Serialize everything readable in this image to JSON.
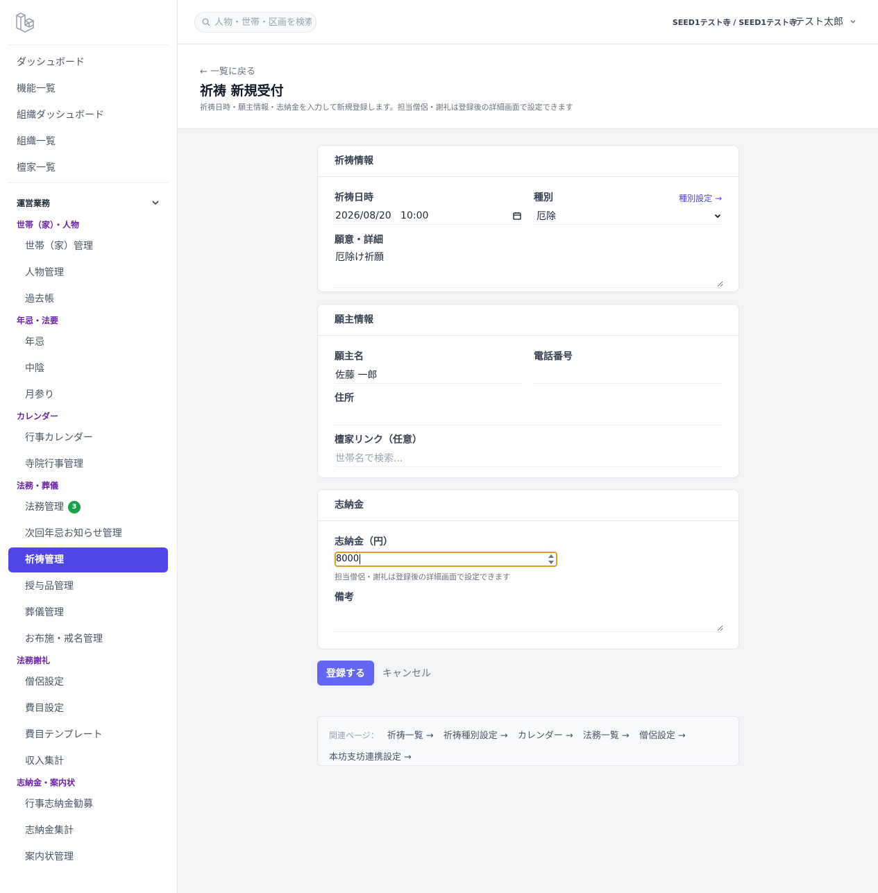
{
  "search": {
    "placeholder": "人物・世帯・区画を検索"
  },
  "header": {
    "org": "SEED1テスト寺 / SEED1テスト寺",
    "user": "テスト太郎"
  },
  "sidebar": {
    "top_items": [
      "ダッシュボード",
      "機能一覧",
      "組織ダッシュボード",
      "組織一覧",
      "檀家一覧"
    ],
    "group_label": "運営業務",
    "sections": [
      {
        "title": "世帯（家）・人物",
        "items": [
          "世帯（家）管理",
          "人物管理",
          "過去帳"
        ]
      },
      {
        "title": "年忌・法要",
        "items": [
          "年忌",
          "中陰",
          "月参り"
        ]
      },
      {
        "title": "カレンダー",
        "items": [
          "行事カレンダー",
          "寺院行事管理"
        ]
      },
      {
        "title": "法務・葬儀",
        "items": [
          "法務管理",
          "次回年忌お知らせ管理",
          "祈祷管理",
          "授与品管理",
          "葬儀管理",
          "お布施・戒名管理"
        ]
      },
      {
        "title": "法務謝礼",
        "items": [
          "僧侶設定",
          "費目設定",
          "費目テンプレート",
          "収入集計"
        ]
      },
      {
        "title": "志納金・案内状",
        "items": [
          "行事志納金勧募",
          "志納金集計",
          "案内状管理"
        ]
      }
    ],
    "badge_count": "3"
  },
  "page": {
    "back": "← 一覧に戻る",
    "title": "祈祷 新規受付",
    "subtitle": "祈祷日時・願主情報・志納金を入力して新規登録します。担当僧侶・謝礼は登録後の詳細画面で設定できます"
  },
  "prayer_card": {
    "title": "祈祷情報",
    "datetime_label": "祈祷日時",
    "datetime_value": "2026/08/20   10:00",
    "type_label": "種別",
    "type_value": "厄除",
    "type_link": "種別設定 →",
    "wish_label": "願意・詳細",
    "wish_value": "厄除け祈願"
  },
  "applicant_card": {
    "title": "願主情報",
    "name_label": "願主名",
    "name_value": "佐藤 一郎",
    "phone_label": "電話番号",
    "phone_value": "",
    "address_label": "住所",
    "address_value": "",
    "danka_label": "檀家リンク（任意）",
    "danka_placeholder": "世帯名で検索..."
  },
  "donation_card": {
    "title": "志納金",
    "amount_label": "志納金（円）",
    "amount_value": "8000",
    "hint": "担当僧侶・謝礼は登録後の詳細画面で設定できます",
    "note_label": "備考",
    "note_value": ""
  },
  "actions": {
    "submit": "登録する",
    "cancel": "キャンセル"
  },
  "related": {
    "label": "関連ページ：",
    "links": [
      "祈祷一覧 →",
      "祈祷種別設定 →",
      "カレンダー →",
      "法務一覧 →",
      "僧侶設定 →",
      "本坊支坊連携設定 →"
    ]
  },
  "colors": {
    "accent": "#5046e5",
    "section": "#6b21a8",
    "badge": "#16a34a",
    "focus": "#e39b27"
  }
}
